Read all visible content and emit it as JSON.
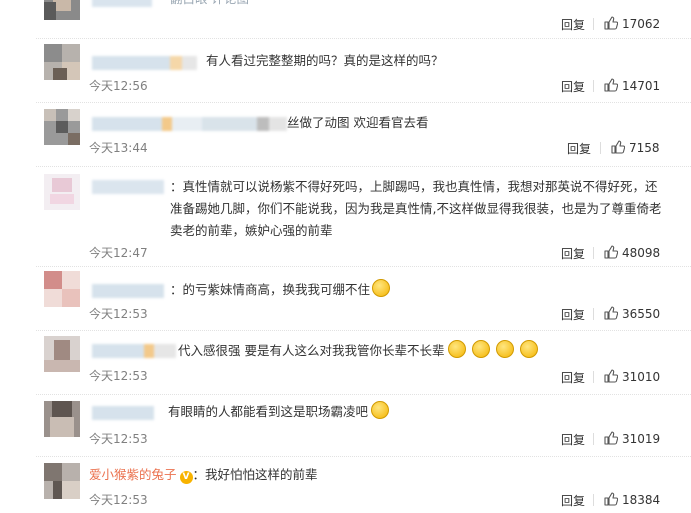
{
  "comments": [
    {
      "text": "翻白眼 评论图",
      "time": "",
      "reply": "回复",
      "likes": "17062"
    },
    {
      "text": "有人看过完整整期的吗？真的是这样的吗？",
      "time": "今天12:56",
      "reply": "回复",
      "likes": "14701"
    },
    {
      "text": "丝做了动图 欢迎看官去看",
      "time": "今天13:44",
      "reply": "回复",
      "likes": "7158"
    },
    {
      "text": "：真性情就可以说杨紫不得好死吗，上脚踢吗，我也真性情，我想对那英说不得好死，还准备踢她几脚，你们不能说我，因为我是真性情,不这样做显得我很装，也是为了尊重倚老卖老的前辈，嫉妒心强的前辈",
      "time": "今天12:47",
      "reply": "回复",
      "likes": "48098"
    },
    {
      "text": "：的亏紫妹情商高，换我我可绷不住",
      "time": "今天12:53",
      "reply": "回复",
      "likes": "36550"
    },
    {
      "text": "代入感很强 要是有人这么对我我管你长辈不长辈",
      "time": "今天12:53",
      "reply": "回复",
      "likes": "31010"
    },
    {
      "text": "有眼睛的人都能看到这是职场霸凌吧",
      "time": "今天12:53",
      "reply": "回复",
      "likes": "31019"
    },
    {
      "username": "爱小猴紫的兔子",
      "text": "：我好怕怕这样的前辈",
      "time": "今天12:53",
      "reply": "回复",
      "likes": "18384"
    }
  ]
}
